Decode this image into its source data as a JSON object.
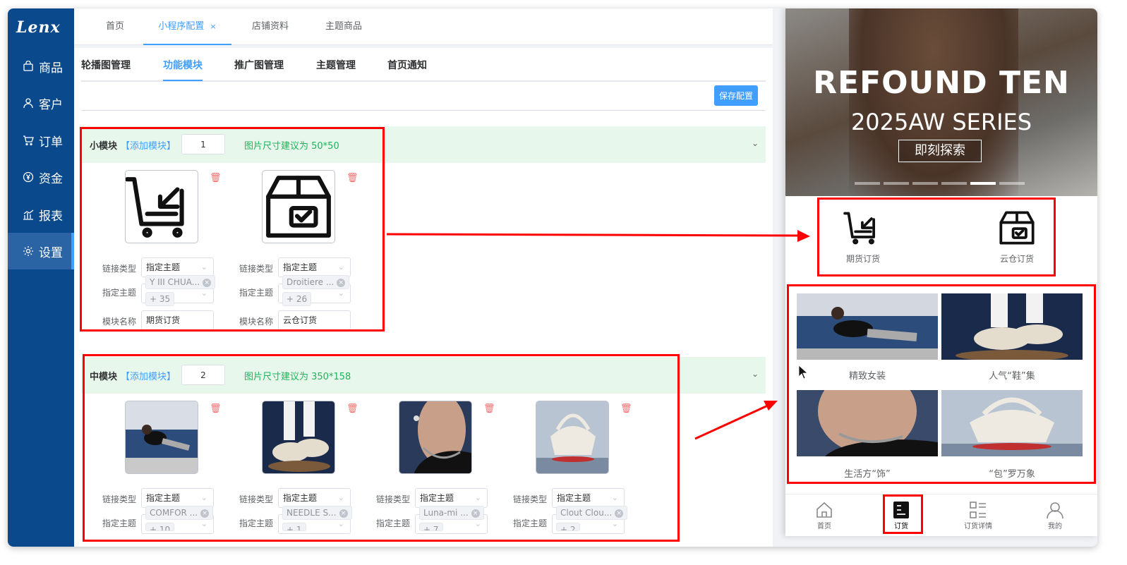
{
  "brand": "Lenx",
  "sidebar": {
    "items": [
      {
        "label": "商品",
        "icon": "bag-icon"
      },
      {
        "label": "客户",
        "icon": "user-icon"
      },
      {
        "label": "订单",
        "icon": "cart-icon"
      },
      {
        "label": "资金",
        "icon": "yen-icon"
      },
      {
        "label": "报表",
        "icon": "chart-icon"
      },
      {
        "label": "设置",
        "icon": "gear-icon"
      }
    ],
    "active": "设置"
  },
  "top_tabs": [
    "首页",
    "小程序配置",
    "店铺资料",
    "主题商品"
  ],
  "top_tab_close": "×",
  "sub_tabs": [
    "轮播图管理",
    "功能模块",
    "推广图管理",
    "主题管理",
    "首页通知"
  ],
  "save_button": "保存配置",
  "small_module": {
    "title": "小模块",
    "add": "【添加模块】",
    "order": "1",
    "tip": "图片尺寸建议为 50*50",
    "labels": {
      "link_type": "链接类型",
      "theme": "指定主题",
      "name": "模块名称"
    },
    "cards": [
      {
        "link": "指定主题",
        "tag": "Y III CHUA...",
        "more": "+ 35",
        "name": "期货订货",
        "icon": "cart-order-icon"
      },
      {
        "link": "指定主题",
        "tag": "Droitiere ...",
        "more": "+ 26",
        "name": "云仓订货",
        "icon": "box-check-icon"
      }
    ]
  },
  "medium_module": {
    "title": "中模块",
    "add": "【添加模块】",
    "order": "2",
    "tip": "图片尺寸建议为 350*158",
    "labels": {
      "link_type": "链接类型",
      "theme": "指定主题"
    },
    "cards": [
      {
        "link": "指定主题",
        "tag": "COMFOR ...",
        "more": "+ 10"
      },
      {
        "link": "指定主题",
        "tag": "NEEDLE S...",
        "more": "+ 1"
      },
      {
        "link": "指定主题",
        "tag": "Luna-mi ...",
        "more": "+ 7"
      },
      {
        "link": "指定主题",
        "tag": "Clout Clou...",
        "more": "+ 2"
      }
    ]
  },
  "phone": {
    "banner_title": "REFOUND TEN",
    "banner_sub": "2025AW SERIES",
    "banner_btn": "即刻探索",
    "banner_active_dot": 5,
    "icons": [
      {
        "label": "期货订货",
        "icon": "cart-order-icon"
      },
      {
        "label": "云仓订货",
        "icon": "box-check-icon"
      }
    ],
    "tiles": [
      "精致女装",
      "人气“鞋”集",
      "生活方“饰”",
      "“包”罗万象"
    ],
    "tabbar": [
      {
        "label": "首页",
        "icon": "home-icon"
      },
      {
        "label": "订货",
        "icon": "order-icon"
      },
      {
        "label": "订货详情",
        "icon": "list-icon"
      },
      {
        "label": "我的",
        "icon": "profile-icon"
      }
    ],
    "tabbar_active": "订货"
  }
}
